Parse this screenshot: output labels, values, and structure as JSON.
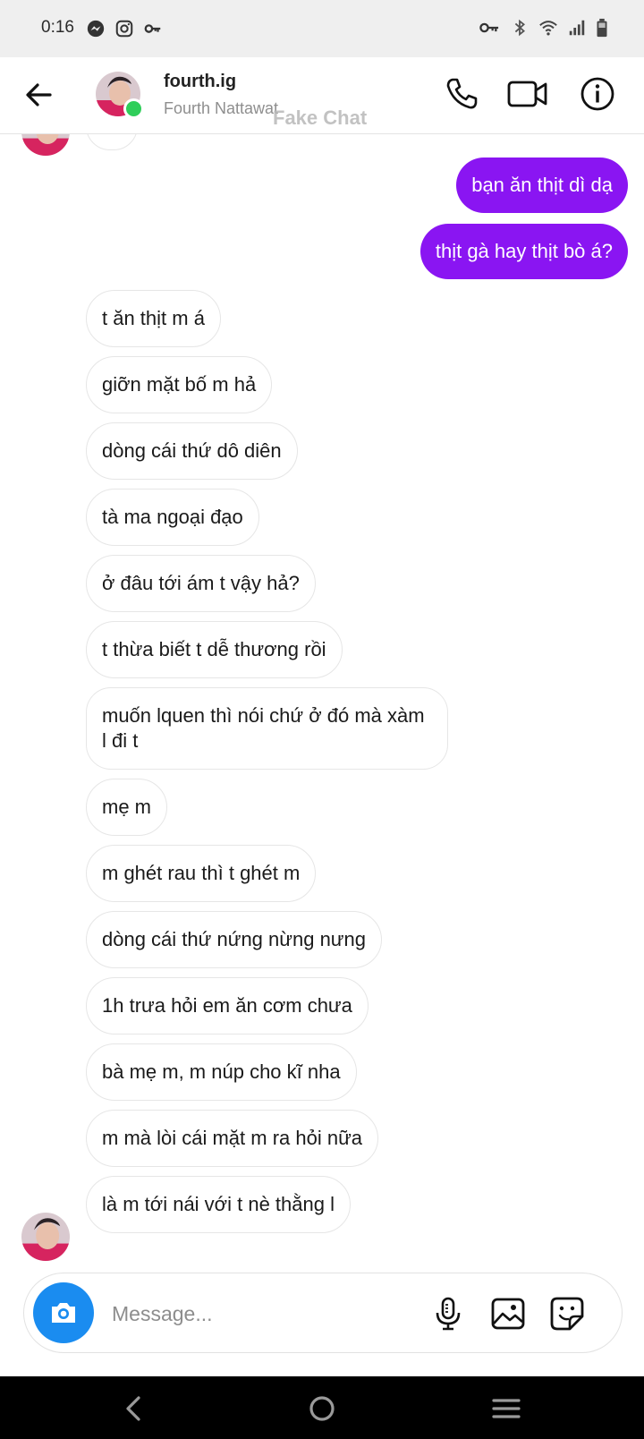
{
  "status_bar": {
    "time": "0:16",
    "left_icons": [
      "messenger-icon",
      "instagram-icon",
      "vpn-key-icon"
    ],
    "right_icons": [
      "vpn-key-icon",
      "bluetooth-icon",
      "wifi-icon",
      "signal-icon",
      "battery-icon"
    ]
  },
  "header": {
    "name": "fourth.ig",
    "subtitle": "Fourth Nattawat",
    "watermark": "Fake Chat",
    "online": true
  },
  "messages": [
    {
      "dir": "out",
      "text": "bạn ăn thịt dì dạ"
    },
    {
      "dir": "out",
      "text": "thịt gà hay thịt bò á?"
    },
    {
      "dir": "in",
      "text": "t ăn thịt m á"
    },
    {
      "dir": "in",
      "text": "giỡn mặt bố m hả"
    },
    {
      "dir": "in",
      "text": "dòng cái thứ dô diên"
    },
    {
      "dir": "in",
      "text": "tà ma ngoại đạo"
    },
    {
      "dir": "in",
      "text": "ở đâu tới ám t vậy hả?"
    },
    {
      "dir": "in",
      "text": "t thừa biết t dễ thương rồi"
    },
    {
      "dir": "in",
      "text": "muốn lquen thì nói chứ ở đó mà xàm l đi t"
    },
    {
      "dir": "in",
      "text": "mẹ m"
    },
    {
      "dir": "in",
      "text": "m ghét rau thì t ghét m"
    },
    {
      "dir": "in",
      "text": "dòng cái thứ nứng nừng nưng"
    },
    {
      "dir": "in",
      "text": "1h trưa hỏi em ăn cơm chưa"
    },
    {
      "dir": "in",
      "text": "bà mẹ m, m núp cho kĩ nha"
    },
    {
      "dir": "in",
      "text": "m mà lòi cái mặt m ra hỏi nữa"
    },
    {
      "dir": "in",
      "text": "là m tới nái với t nè thằng l"
    }
  ],
  "composer": {
    "placeholder": "Message...",
    "icons": [
      "camera-icon",
      "microphone-icon",
      "gallery-icon",
      "sticker-icon"
    ]
  },
  "colors": {
    "outgoing_bubble": "#8a15f2",
    "camera_button": "#1a8cf0",
    "online_dot": "#2fce5a"
  }
}
